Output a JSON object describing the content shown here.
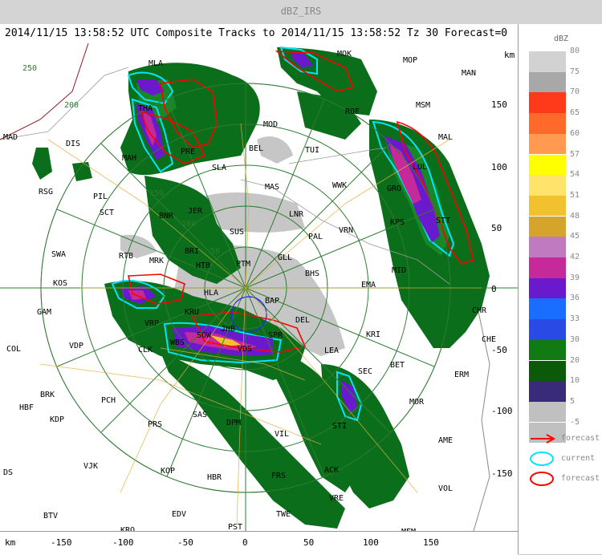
{
  "window": {
    "title": "dBZ_IRS"
  },
  "header": {
    "text": "2014/11/15 13:58:52 UTC Composite Tracks to 2014/11/15 13:58:52 Tz 30 Forecast=0"
  },
  "legend": {
    "title": "dBZ",
    "bins": [
      {
        "label": "80",
        "color": "#d2d2d2"
      },
      {
        "label": "75",
        "color": "#a8a8a8"
      },
      {
        "label": "70",
        "color": "#ff3a1a"
      },
      {
        "label": "65",
        "color": "#ff6a2a"
      },
      {
        "label": "60",
        "color": "#ff9a50"
      },
      {
        "label": "57",
        "color": "#ffff00"
      },
      {
        "label": "54",
        "color": "#ffe36a"
      },
      {
        "label": "51",
        "color": "#f2c22e"
      },
      {
        "label": "48",
        "color": "#d4a52a"
      },
      {
        "label": "45",
        "color": "#c07abf"
      },
      {
        "label": "42",
        "color": "#c62a9a"
      },
      {
        "label": "39",
        "color": "#6a1acc"
      },
      {
        "label": "36",
        "color": "#1a6eff"
      },
      {
        "label": "33",
        "color": "#2a4ae6"
      },
      {
        "label": "30",
        "color": "#127a12"
      },
      {
        "label": "20",
        "color": "#0a5a0a"
      },
      {
        "label": "10",
        "color": "#3a2a7a"
      },
      {
        "label": "5",
        "color": "#c0c0c0"
      },
      {
        "label": "-5",
        "color": "#c0c0c0"
      }
    ],
    "symbols": [
      {
        "label": "forecast",
        "kind": "arrow",
        "color": "#ff0000"
      },
      {
        "label": "current",
        "kind": "ellipse",
        "color": "#00e5ff"
      },
      {
        "label": "forecast",
        "kind": "ellipse",
        "color": "#ff0000"
      }
    ]
  },
  "map": {
    "axis_unit": "km",
    "x_ticks": [
      "-150",
      "-100",
      "-50",
      "0",
      "50",
      "100",
      "150"
    ],
    "y_ticks": [
      "150",
      "100",
      "50",
      "0",
      "-50",
      "-100",
      "-150"
    ],
    "ring_labels": [
      "50",
      "100",
      "150",
      "200",
      "250"
    ],
    "stations": [
      "MLA",
      "MOK",
      "MOP",
      "MAN",
      "THA",
      "ROE",
      "MSM",
      "MAD",
      "DIS",
      "MOD",
      "TUI",
      "BEL",
      "MAL",
      "SLA",
      "MAH",
      "PRE",
      "RSG",
      "PIL",
      "MAS",
      "WWK",
      "GRO",
      "LUL",
      "SCT",
      "JER",
      "LNR",
      "KPS",
      "STT",
      "BNR",
      "PAL",
      "VRN",
      "SWA",
      "RTB",
      "SUS",
      "MRK",
      "BRI",
      "GLL",
      "MID",
      "KOS",
      "HTB",
      "PTM",
      "BHS",
      "EMA",
      "HLA",
      "BAP",
      "GAM",
      "KRU",
      "CHR",
      "VRP",
      "DEL",
      "JHB",
      "KRI",
      "COL",
      "VDP",
      "CLK",
      "WBS",
      "SOW",
      "SPR",
      "VDS",
      "LEA",
      "BET",
      "SEC",
      "ERM",
      "BRK",
      "HBF",
      "KDP",
      "PCH",
      "SAS",
      "MOR",
      "PRS",
      "DPM",
      "VIL",
      "AME",
      "VJK",
      "KOP",
      "FRS",
      "HBR",
      "BTV",
      "VOL",
      "ACK",
      "EDV",
      "TWE",
      "PST",
      "KRO",
      "MFM",
      "CHE",
      "VRE",
      "DS",
      "STI"
    ]
  }
}
